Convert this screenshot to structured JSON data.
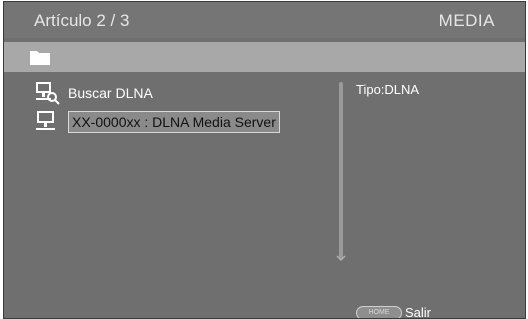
{
  "header": {
    "item_counter": "Artículo 2 / 3",
    "section_title": "MEDIA"
  },
  "pathbar": {
    "icon": "folder-icon"
  },
  "list": {
    "items": [
      {
        "label": "Buscar DLNA",
        "icon": "search-dlna-icon",
        "selected": false
      },
      {
        "label": "XX-0000xx : DLNA Media Server",
        "icon": "computer-icon",
        "selected": true
      }
    ]
  },
  "info": {
    "type_label": "Tipo:DLNA"
  },
  "footer": {
    "home_button_label": "HOME",
    "exit_label": "Salir"
  },
  "colors": {
    "background": "#6f6f6f",
    "pathbar": "#a8a8a8",
    "text": "#ffffff"
  }
}
